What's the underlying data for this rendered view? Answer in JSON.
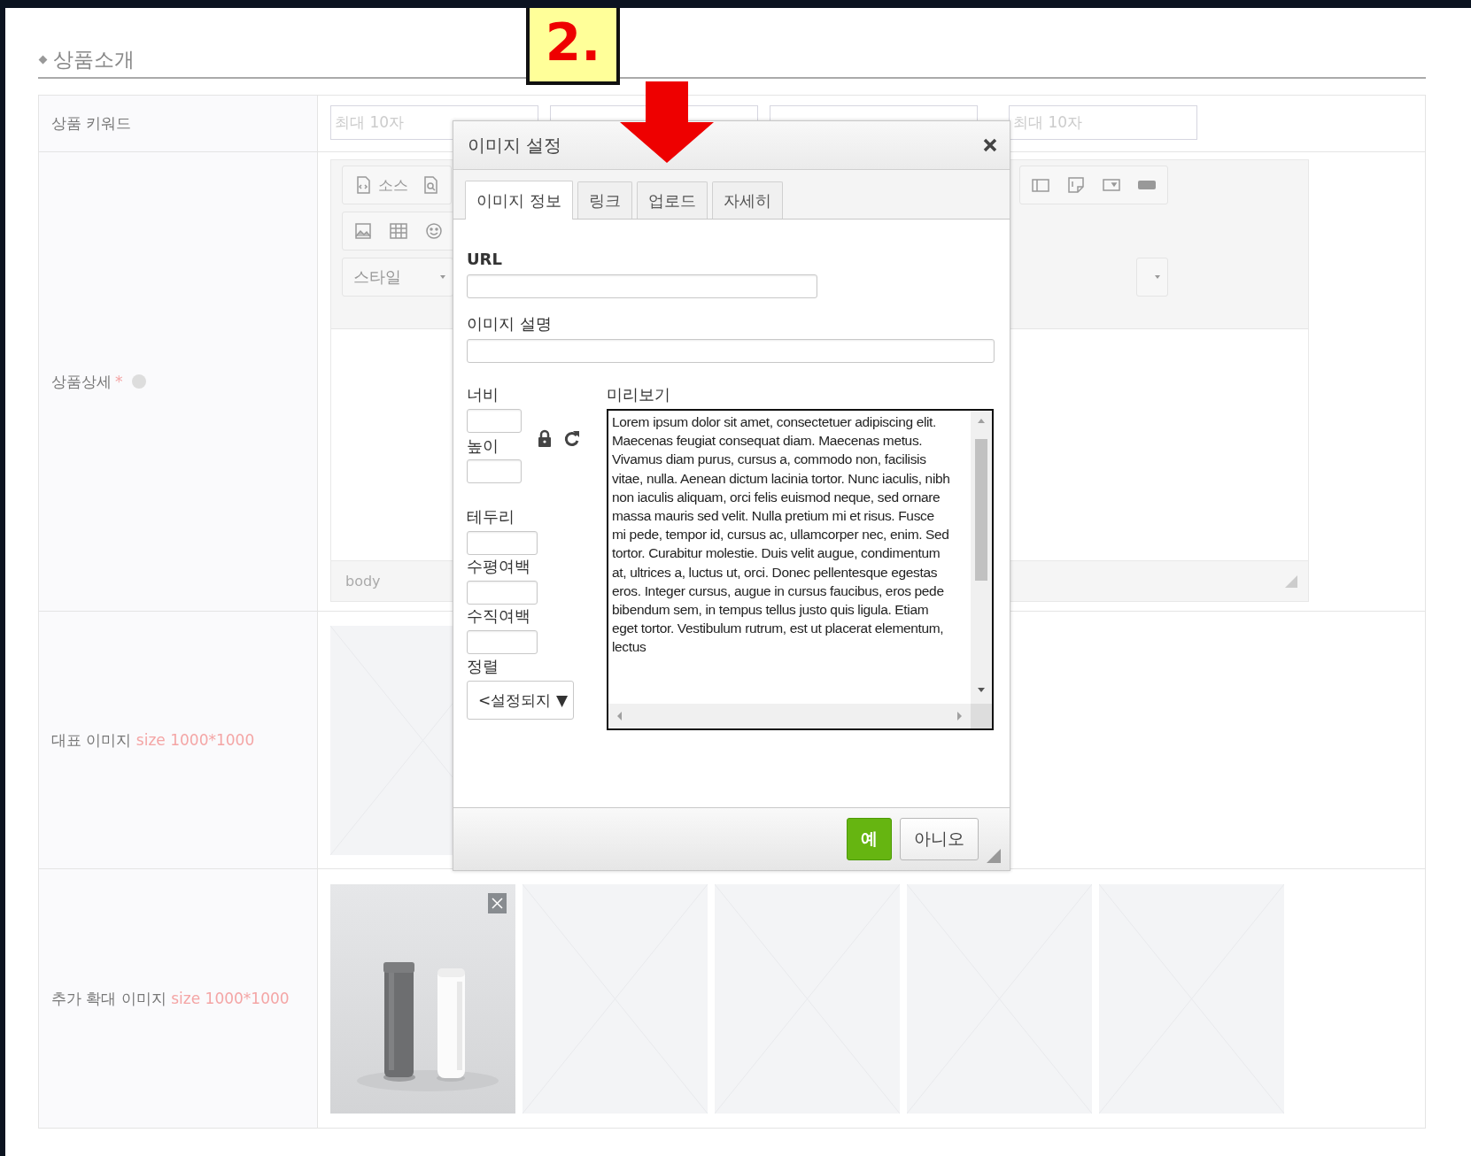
{
  "annotation": {
    "step": "2."
  },
  "section": {
    "title": "상품소개"
  },
  "form": {
    "keyword_row": {
      "label": "상품 키워드",
      "inputs": [
        {
          "kind": "hinted",
          "placeholder": "최대 10자"
        },
        {
          "kind": "blank"
        },
        {
          "kind": "blank"
        },
        {
          "kind": "hinted",
          "placeholder": "최대 10자"
        }
      ]
    },
    "detail_row": {
      "label": "상품상세",
      "required_mark": "*",
      "editor": {
        "source_button": "소스",
        "style_dropdown": "스타일",
        "status": "body"
      }
    },
    "main_image_row": {
      "label": "대표 이미지",
      "hint": "size 1000*1000"
    },
    "extra_image_row": {
      "label": "추가 확대 이미지",
      "hint": "size 1000*1000",
      "slots": [
        {
          "kind": "picture"
        },
        {
          "kind": "empty"
        },
        {
          "kind": "empty"
        },
        {
          "kind": "empty"
        },
        {
          "kind": "empty"
        }
      ]
    }
  },
  "dialog": {
    "title": "이미지 설정",
    "tabs": [
      {
        "label": "이미지 정보",
        "selected": true
      },
      {
        "label": "링크",
        "selected": false
      },
      {
        "label": "업로드",
        "selected": false
      },
      {
        "label": "자세히",
        "selected": false
      }
    ],
    "url_label": "URL",
    "description_label": "이미지 설명",
    "width_label": "너비",
    "height_label": "높이",
    "border_label": "테두리",
    "hspace_label": "수평여백",
    "vspace_label": "수직여백",
    "align_label": "정렬",
    "align_select": {
      "value": "<설정되지",
      "caret": "▼"
    },
    "preview": {
      "label": "미리보기",
      "text": "Lorem ipsum dolor sit amet, consectetuer adipiscing elit. Maecenas feugiat consequat diam. Maecenas metus. Vivamus diam purus, cursus a, commodo non, facilisis vitae, nulla. Aenean dictum lacinia tortor. Nunc iaculis, nibh non iaculis aliquam, orci felis euismod neque, sed ornare massa mauris sed velit. Nulla pretium mi et risus. Fusce mi pede, tempor id, cursus ac, ullamcorper nec, enim. Sed tortor. Curabitur molestie. Duis velit augue, condimentum at, ultrices a, luctus ut, orci. Donec pellentesque egestas eros. Integer cursus, augue in cursus faucibus, eros pede bibendum sem, in tempus tellus justo quis ligula. Etiam eget tortor. Vestibulum rutrum, est ut placerat elementum, lectus"
    },
    "buttons": [
      {
        "label": "예",
        "kind": "primary"
      },
      {
        "label": "아니오",
        "kind": "secondary"
      }
    ]
  }
}
